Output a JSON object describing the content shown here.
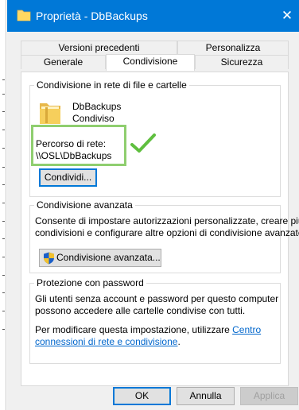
{
  "window": {
    "title": "Proprietà - DbBackups",
    "close_glyph": "✕",
    "accent": "#0078d7"
  },
  "tabs": {
    "row_back": [
      "Versioni precedenti",
      "Personalizza"
    ],
    "row_front": [
      "Generale",
      "Condivisione",
      "Sicurezza"
    ],
    "active": "Condivisione"
  },
  "network_sharing": {
    "title": "Condivisione in rete di file e cartelle",
    "folder_name": "DbBackups",
    "folder_status": "Condiviso",
    "path_label": "Percorso di rete:",
    "path_value": "\\\\OSL\\DbBackups",
    "share_button": "Condividi..."
  },
  "advanced_sharing": {
    "title": "Condivisione avanzata",
    "description_line1": "Consente di impostare autorizzazioni personalizzate, creare più",
    "description_line2": "condivisioni e configurare altre opzioni di condivisione avanzate.",
    "button": "Condivisione avanzata..."
  },
  "password_protection": {
    "title": "Protezione con password",
    "description_line1": "Gli utenti senza account e password per questo computer",
    "description_line2": "possono accedere alle cartelle condivise con tutti.",
    "change_line1": "Per modificare questa impostazione, utilizzare",
    "link_part1": "Centro",
    "link_part2": "connessioni di rete e condivisione",
    "link_end": "."
  },
  "footer": {
    "ok": "OK",
    "cancel": "Annulla",
    "apply": "Applica"
  },
  "annotation": {
    "highlight_color": "#8fce6f",
    "check_color": "#5fbf3f"
  }
}
